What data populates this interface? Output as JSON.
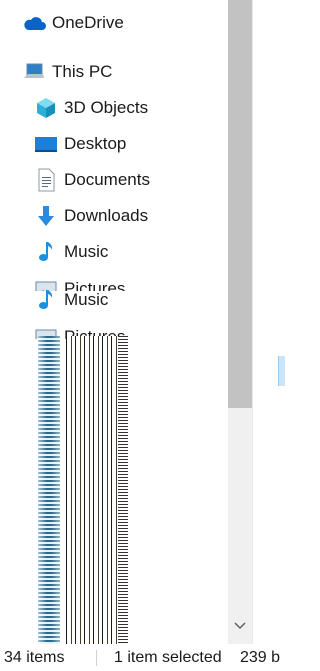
{
  "nav": {
    "onedrive": "OneDrive",
    "this_pc": "This PC",
    "items": [
      {
        "label": "3D Objects",
        "icon": "cube-icon"
      },
      {
        "label": "Desktop",
        "icon": "desktop-icon"
      },
      {
        "label": "Documents",
        "icon": "documents-icon"
      },
      {
        "label": "Downloads",
        "icon": "download-arrow-icon"
      },
      {
        "label": "Music",
        "icon": "music-note-icon"
      },
      {
        "label": "Pictures",
        "icon": "pictures-icon"
      },
      {
        "label": "Music",
        "icon": "music-note-icon"
      },
      {
        "label": "Pictures",
        "icon": "pictures-icon"
      }
    ]
  },
  "status": {
    "count": "34 items",
    "selected": "1 item selected",
    "size": "239 b"
  },
  "colors": {
    "accent": "#0078d7",
    "scroll_thumb": "#c2c2c2",
    "scroll_track": "#f0f0f0"
  }
}
